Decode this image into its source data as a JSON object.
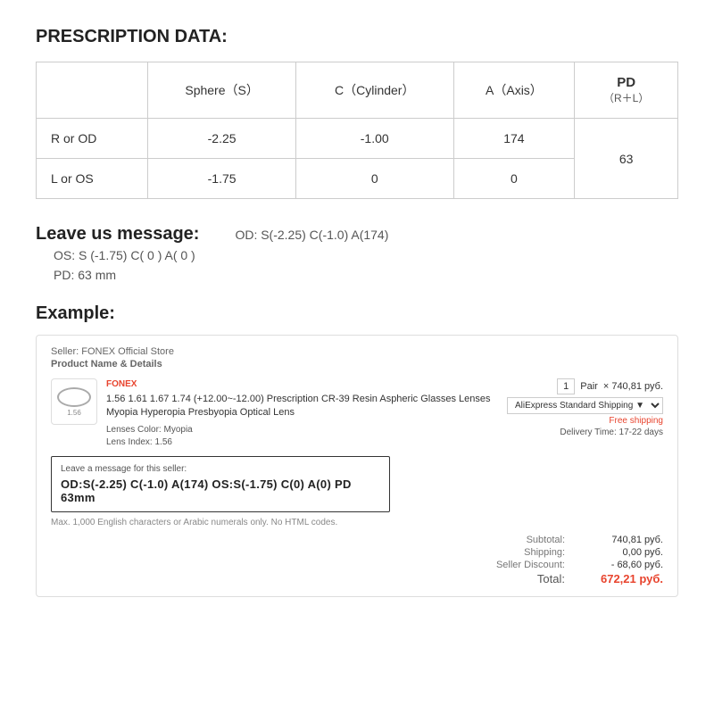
{
  "page": {
    "title": "PRESCRIPTION DATA:"
  },
  "table": {
    "headers": {
      "eye": "",
      "sphere": "Sphere（S）",
      "cylinder": "C（Cylinder）",
      "axis": "A（Axis）",
      "pd_label": "PD",
      "pd_sub": "（R＋L）"
    },
    "rows": [
      {
        "eye": "R or OD",
        "sphere": "-2.25",
        "cylinder": "-1.00",
        "axis": "174",
        "pd": "63"
      },
      {
        "eye": "L or OS",
        "sphere": "-1.75",
        "cylinder": "0",
        "axis": "0",
        "pd": ""
      }
    ]
  },
  "leave_message": {
    "label": "Leave us message:",
    "lines": [
      "OD:  S(-2.25)    C(-1.0)   A(174)",
      "OS:  S (-1.75)    C( 0 )    A( 0 )",
      "PD:  63 mm"
    ]
  },
  "example": {
    "title": "Example:",
    "seller": "Seller: FONEX Official Store",
    "product_label": "Product Name & Details",
    "brand": "FONEX",
    "product_desc": "1.56 1.61 1.67 1.74 (+12.00~-12.00) Prescription CR-39 Resin Aspheric Glasses Lenses Myopia Hyperopia Presbyopia Optical Lens",
    "lens_color_label": "Lenses Color:",
    "lens_color": "Myopia",
    "lens_index_label": "Lens Index:",
    "lens_index": "1.56",
    "qty": "1",
    "qty_unit": "Pair",
    "price": "×  740,81 руб.",
    "shipping_option": "AliExpress Standard Shipping ▼",
    "free_shipping": "Free shipping",
    "delivery": "Delivery Time: 17-22 days",
    "message_area_label": "Leave a message for this seller:",
    "message_text": "OD:S(-2.25) C(-1.0) A(174)   OS:S(-1.75) C(0) A(0)  PD  63mm",
    "message_hint": "Max. 1,000 English characters or Arabic numerals only. No HTML codes.",
    "totals": {
      "subtotal_label": "Subtotal:",
      "subtotal_value": "740,81 руб.",
      "shipping_label": "Shipping:",
      "shipping_value": "0,00 руб.",
      "discount_label": "Seller Discount:",
      "discount_value": "- 68,60 руб.",
      "total_label": "Total:",
      "total_value": "672,21 руб."
    }
  }
}
